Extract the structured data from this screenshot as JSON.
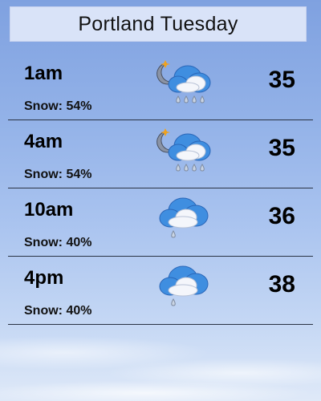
{
  "header": {
    "title": "Portland Tuesday"
  },
  "forecast": [
    {
      "time": "1am",
      "snow": "Snow: 54%",
      "temp": "35",
      "icon": "night-cloud-snow-icon"
    },
    {
      "time": "4am",
      "snow": "Snow: 54%",
      "temp": "35",
      "icon": "night-cloud-snow-icon"
    },
    {
      "time": "10am",
      "snow": "Snow: 40%",
      "temp": "36",
      "icon": "cloud-light-snow-icon"
    },
    {
      "time": "4pm",
      "snow": "Snow: 40%",
      "temp": "38",
      "icon": "cloud-light-snow-icon"
    }
  ],
  "colors": {
    "cloud_back": "#3f8ee0",
    "cloud_front": "#f4f6fb",
    "drop": "#c9d4e3",
    "moon": "#8a93a5",
    "star": "#f0a21e"
  }
}
